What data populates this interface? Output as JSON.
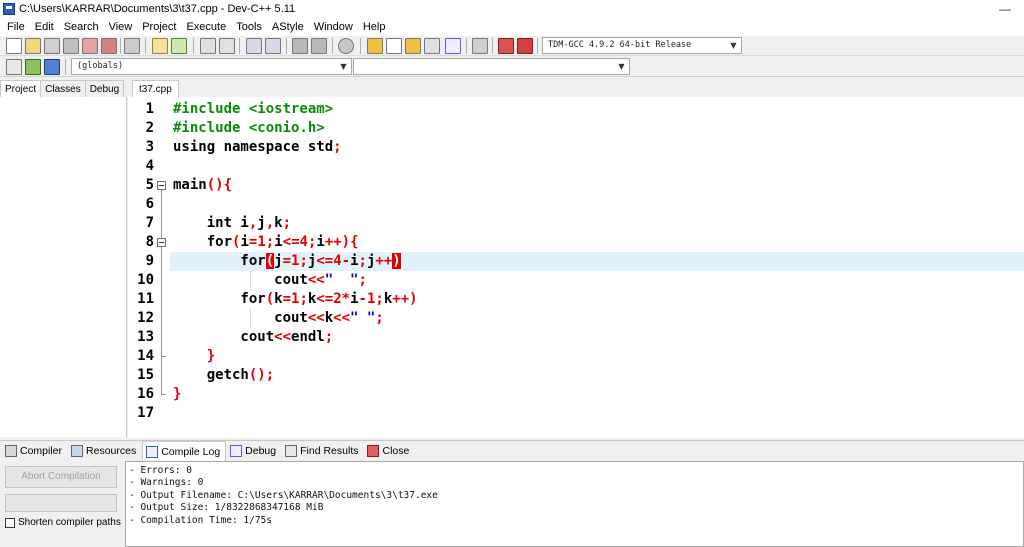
{
  "window": {
    "title": "C:\\Users\\KARRAR\\Documents\\3\\t37.cpp - Dev-C++ 5.11"
  },
  "menu": [
    "File",
    "Edit",
    "Search",
    "View",
    "Project",
    "Execute",
    "Tools",
    "AStyle",
    "Window",
    "Help"
  ],
  "toolbar": {
    "compiler_select": "TDM-GCC 4.9.2 64-bit Release",
    "scope_select": "(globals)",
    "symbol_select": ""
  },
  "left_panel": {
    "tabs": [
      "Project",
      "Classes",
      "Debug"
    ],
    "active": "Project"
  },
  "editor": {
    "tab": "t37.cpp",
    "line_numbers": [
      "1",
      "2",
      "3",
      "4",
      "5",
      "6",
      "7",
      "8",
      "9",
      "10",
      "11",
      "12",
      "13",
      "14",
      "15",
      "16",
      "17"
    ],
    "current_line": 9
  },
  "bottom": {
    "tabs": [
      "Compiler",
      "Resources",
      "Compile Log",
      "Debug",
      "Find Results",
      "Close"
    ],
    "active_tab": "Compile Log",
    "abort_label": "Abort Compilation",
    "shorten_label": "Shorten compiler paths",
    "log": [
      "- Errors: 0",
      "- Warnings: 0",
      "- Output Filename: C:\\Users\\KARRAR\\Documents\\3\\t37.exe",
      "- Output Size: 1/8322868347168 MiB",
      "- Compilation Time: 1/75s"
    ]
  },
  "colors": {
    "current_line": "#e1f0f9",
    "preprocessor": "#0a8a0a",
    "symbol": "#e00000",
    "string": "#0000e0"
  }
}
